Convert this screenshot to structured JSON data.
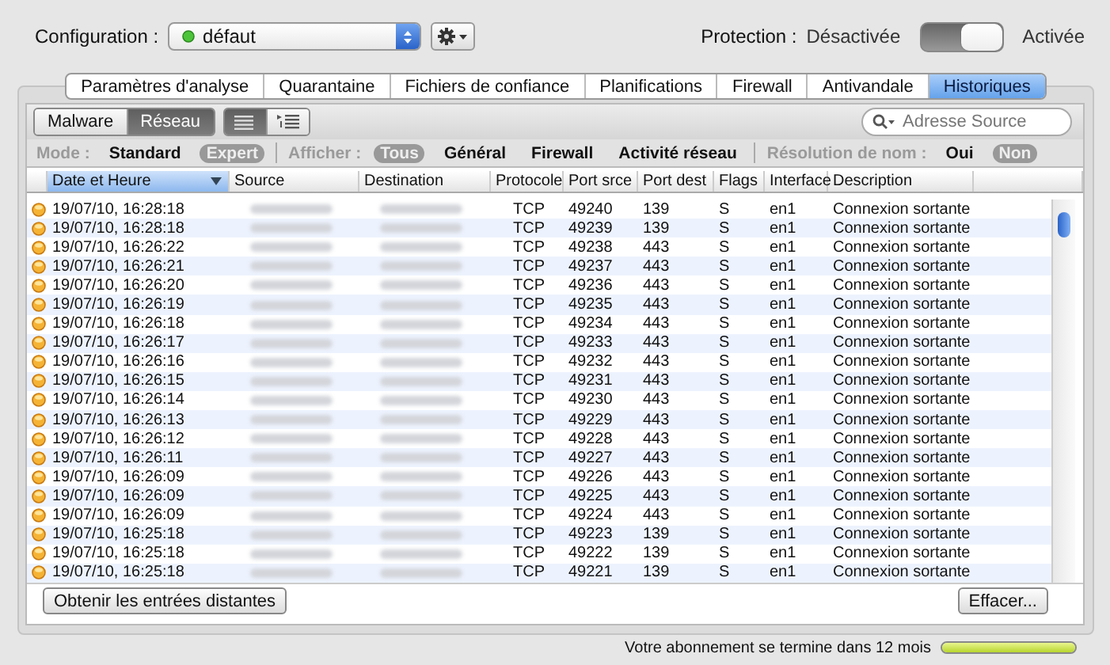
{
  "config": {
    "label": "Configuration :",
    "value": "défaut"
  },
  "protection": {
    "label": "Protection :",
    "off_label": "Désactivée",
    "on_label": "Activée",
    "on": true
  },
  "tabs": [
    {
      "label": "Paramètres d'analyse",
      "selected": false
    },
    {
      "label": "Quarantaine",
      "selected": false
    },
    {
      "label": "Fichiers de confiance",
      "selected": false
    },
    {
      "label": "Planifications",
      "selected": false
    },
    {
      "label": "Firewall",
      "selected": false
    },
    {
      "label": "Antivandale",
      "selected": false
    },
    {
      "label": "Historiques",
      "selected": true
    }
  ],
  "segments": [
    {
      "label": "Malware",
      "selected": false
    },
    {
      "label": "Réseau",
      "selected": true
    }
  ],
  "view_buttons": [
    {
      "kind": "list",
      "selected": true
    },
    {
      "kind": "outline",
      "selected": false
    }
  ],
  "search": {
    "placeholder": "Adresse Source"
  },
  "filters": [
    {
      "label": "Mode :",
      "options": [
        {
          "label": "Standard",
          "selected": false
        },
        {
          "label": "Expert",
          "selected": true
        }
      ]
    },
    {
      "label": "Afficher :",
      "options": [
        {
          "label": "Tous",
          "selected": true
        },
        {
          "label": "Général",
          "selected": false
        },
        {
          "label": "Firewall",
          "selected": false
        },
        {
          "label": "Activité réseau",
          "selected": false
        }
      ]
    },
    {
      "label": "Résolution de nom :",
      "options": [
        {
          "label": "Oui",
          "selected": false
        },
        {
          "label": "Non",
          "selected": true
        }
      ]
    }
  ],
  "table": {
    "columns": [
      "Date et Heure",
      "Source",
      "Destination",
      "Protocole",
      "Port srce",
      "Port dest",
      "Flags",
      "Interface",
      "Description"
    ],
    "rows": [
      {
        "date": "19/07/10, 16:28:18",
        "protocol": "TCP",
        "port_src": "49240",
        "port_dest": "139",
        "flags": "S",
        "interface": "en1",
        "description": "Connexion sortante"
      },
      {
        "date": "19/07/10, 16:28:18",
        "protocol": "TCP",
        "port_src": "49239",
        "port_dest": "139",
        "flags": "S",
        "interface": "en1",
        "description": "Connexion sortante"
      },
      {
        "date": "19/07/10, 16:26:22",
        "protocol": "TCP",
        "port_src": "49238",
        "port_dest": "443",
        "flags": "S",
        "interface": "en1",
        "description": "Connexion sortante"
      },
      {
        "date": "19/07/10, 16:26:21",
        "protocol": "TCP",
        "port_src": "49237",
        "port_dest": "443",
        "flags": "S",
        "interface": "en1",
        "description": "Connexion sortante"
      },
      {
        "date": "19/07/10, 16:26:20",
        "protocol": "TCP",
        "port_src": "49236",
        "port_dest": "443",
        "flags": "S",
        "interface": "en1",
        "description": "Connexion sortante"
      },
      {
        "date": "19/07/10, 16:26:19",
        "protocol": "TCP",
        "port_src": "49235",
        "port_dest": "443",
        "flags": "S",
        "interface": "en1",
        "description": "Connexion sortante"
      },
      {
        "date": "19/07/10, 16:26:18",
        "protocol": "TCP",
        "port_src": "49234",
        "port_dest": "443",
        "flags": "S",
        "interface": "en1",
        "description": "Connexion sortante"
      },
      {
        "date": "19/07/10, 16:26:17",
        "protocol": "TCP",
        "port_src": "49233",
        "port_dest": "443",
        "flags": "S",
        "interface": "en1",
        "description": "Connexion sortante"
      },
      {
        "date": "19/07/10, 16:26:16",
        "protocol": "TCP",
        "port_src": "49232",
        "port_dest": "443",
        "flags": "S",
        "interface": "en1",
        "description": "Connexion sortante"
      },
      {
        "date": "19/07/10, 16:26:15",
        "protocol": "TCP",
        "port_src": "49231",
        "port_dest": "443",
        "flags": "S",
        "interface": "en1",
        "description": "Connexion sortante"
      },
      {
        "date": "19/07/10, 16:26:14",
        "protocol": "TCP",
        "port_src": "49230",
        "port_dest": "443",
        "flags": "S",
        "interface": "en1",
        "description": "Connexion sortante"
      },
      {
        "date": "19/07/10, 16:26:13",
        "protocol": "TCP",
        "port_src": "49229",
        "port_dest": "443",
        "flags": "S",
        "interface": "en1",
        "description": "Connexion sortante"
      },
      {
        "date": "19/07/10, 16:26:12",
        "protocol": "TCP",
        "port_src": "49228",
        "port_dest": "443",
        "flags": "S",
        "interface": "en1",
        "description": "Connexion sortante"
      },
      {
        "date": "19/07/10, 16:26:11",
        "protocol": "TCP",
        "port_src": "49227",
        "port_dest": "443",
        "flags": "S",
        "interface": "en1",
        "description": "Connexion sortante"
      },
      {
        "date": "19/07/10, 16:26:09",
        "protocol": "TCP",
        "port_src": "49226",
        "port_dest": "443",
        "flags": "S",
        "interface": "en1",
        "description": "Connexion sortante"
      },
      {
        "date": "19/07/10, 16:26:09",
        "protocol": "TCP",
        "port_src": "49225",
        "port_dest": "443",
        "flags": "S",
        "interface": "en1",
        "description": "Connexion sortante"
      },
      {
        "date": "19/07/10, 16:26:09",
        "protocol": "TCP",
        "port_src": "49224",
        "port_dest": "443",
        "flags": "S",
        "interface": "en1",
        "description": "Connexion sortante"
      },
      {
        "date": "19/07/10, 16:25:18",
        "protocol": "TCP",
        "port_src": "49223",
        "port_dest": "139",
        "flags": "S",
        "interface": "en1",
        "description": "Connexion sortante"
      },
      {
        "date": "19/07/10, 16:25:18",
        "protocol": "TCP",
        "port_src": "49222",
        "port_dest": "139",
        "flags": "S",
        "interface": "en1",
        "description": "Connexion sortante"
      },
      {
        "date": "19/07/10, 16:25:18",
        "protocol": "TCP",
        "port_src": "49221",
        "port_dest": "139",
        "flags": "S",
        "interface": "en1",
        "description": "Connexion sortante"
      }
    ]
  },
  "buttons": [
    {
      "label": "Obtenir les entrées distantes"
    },
    {
      "label": "Effacer..."
    }
  ],
  "status_bar": {
    "text": "Votre abonnement se termine dans 12 mois",
    "level": 1
  }
}
